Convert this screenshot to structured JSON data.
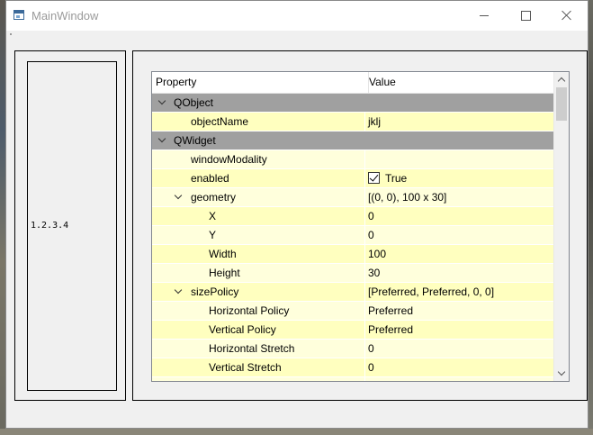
{
  "window": {
    "title": "MainWindow"
  },
  "left_panel": {
    "label": "1.2.3.4"
  },
  "property_browser": {
    "header": {
      "property": "Property",
      "value": "Value"
    },
    "rows": [
      {
        "name": "QObject",
        "value": "",
        "kind": "group",
        "level": 0,
        "expander": "expanded"
      },
      {
        "name": "objectName",
        "value": "jklj",
        "kind": "prop",
        "level": 1,
        "expander": "none"
      },
      {
        "name": "QWidget",
        "value": "",
        "kind": "group",
        "level": 0,
        "expander": "expanded"
      },
      {
        "name": "windowModality",
        "value": "",
        "kind": "prop",
        "level": 1,
        "expander": "none"
      },
      {
        "name": "enabled",
        "value": "True",
        "kind": "check",
        "level": 1,
        "expander": "none",
        "checked": true
      },
      {
        "name": "geometry",
        "value": "[(0, 0), 100 x 30]",
        "kind": "prop",
        "level": 1,
        "expander": "expanded"
      },
      {
        "name": "X",
        "value": "0",
        "kind": "prop",
        "level": 2,
        "expander": "none"
      },
      {
        "name": "Y",
        "value": "0",
        "kind": "prop",
        "level": 2,
        "expander": "none"
      },
      {
        "name": "Width",
        "value": "100",
        "kind": "prop",
        "level": 2,
        "expander": "none"
      },
      {
        "name": "Height",
        "value": "30",
        "kind": "prop",
        "level": 2,
        "expander": "none"
      },
      {
        "name": "sizePolicy",
        "value": "[Preferred, Preferred, 0, 0]",
        "kind": "prop",
        "level": 1,
        "expander": "expanded"
      },
      {
        "name": "Horizontal Policy",
        "value": "Preferred",
        "kind": "prop",
        "level": 2,
        "expander": "none"
      },
      {
        "name": "Vertical Policy",
        "value": "Preferred",
        "kind": "prop",
        "level": 2,
        "expander": "none"
      },
      {
        "name": "Horizontal Stretch",
        "value": "0",
        "kind": "prop",
        "level": 2,
        "expander": "none"
      },
      {
        "name": "Vertical Stretch",
        "value": "0",
        "kind": "prop",
        "level": 2,
        "expander": "none"
      },
      {
        "name": "",
        "value": "",
        "kind": "prop",
        "level": 1,
        "expander": "none"
      }
    ],
    "colors": {
      "group_row": "#a0a0a0",
      "row_primary": "#ffffbf",
      "row_alternate": "#ffffdc"
    }
  }
}
